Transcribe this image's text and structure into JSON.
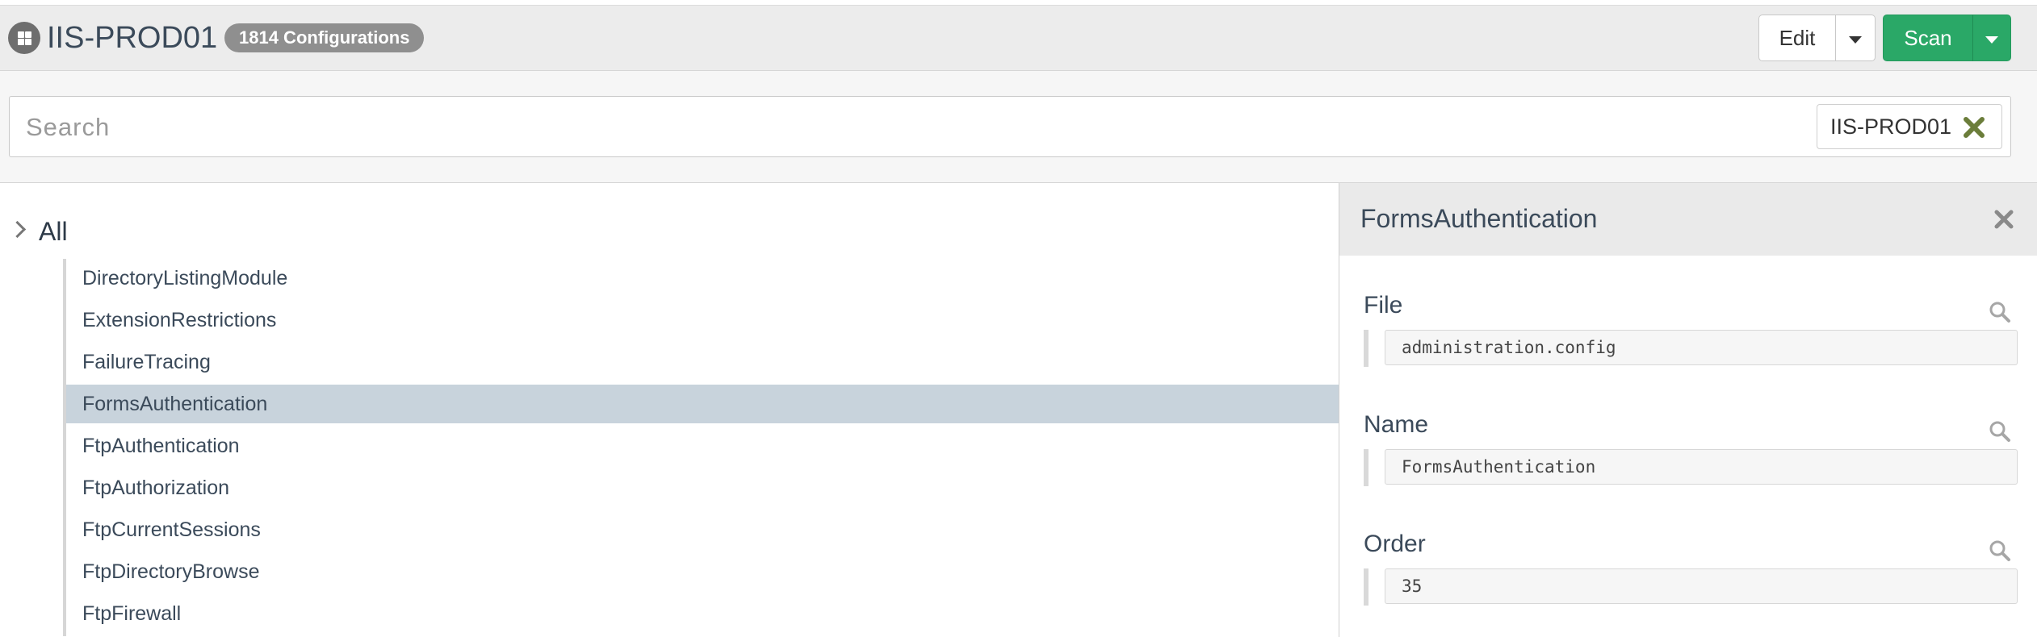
{
  "header": {
    "host_name": "IIS-PROD01",
    "config_badge": "1814 Configurations",
    "edit_label": "Edit",
    "scan_label": "Scan",
    "accent_color": "#2aa867"
  },
  "search": {
    "placeholder": "Search",
    "value": "",
    "filter_tag": "IIS-PROD01"
  },
  "tree": {
    "root_label": "All",
    "items": [
      {
        "label": "DirectoryListingModule"
      },
      {
        "label": "ExtensionRestrictions"
      },
      {
        "label": "FailureTracing"
      },
      {
        "label": "FormsAuthentication"
      },
      {
        "label": "FtpAuthentication"
      },
      {
        "label": "FtpAuthorization"
      },
      {
        "label": "FtpCurrentSessions"
      },
      {
        "label": "FtpDirectoryBrowse"
      },
      {
        "label": "FtpFirewall"
      }
    ],
    "selected_item": "FormsAuthentication"
  },
  "detail": {
    "title": "FormsAuthentication",
    "fields": [
      {
        "label": "File",
        "value": "administration.config"
      },
      {
        "label": "Name",
        "value": "FormsAuthentication"
      },
      {
        "label": "Order",
        "value": "35"
      }
    ]
  },
  "icons": {
    "host": "windows-host-icon",
    "filter_remove": "close-x-icon",
    "panel_close": "close-icon",
    "field_search": "search-icon",
    "tree_expand": "chevron-right-icon"
  }
}
